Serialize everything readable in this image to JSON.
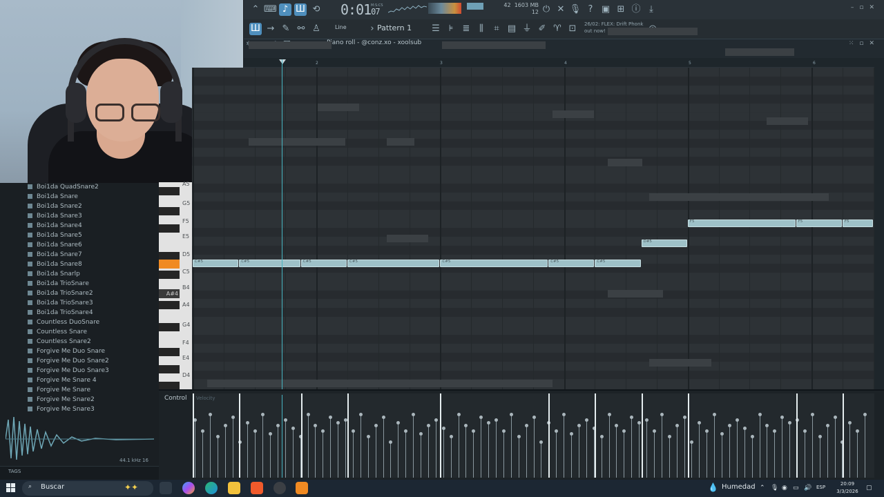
{
  "toolbar": {
    "time_main": "0:01",
    "time_small": "07",
    "time_label": "M:S:CS",
    "cpu_mem": "1603 MB",
    "cpu_voices": "12",
    "cpu_pct": "42",
    "mode": "Line",
    "pattern": "Pattern 1",
    "news_line1": "26/02: FLEX: Drift Phonk",
    "news_line2": "out now!"
  },
  "piano_roll": {
    "title": "Piano roll - @conz.xo - xoolsub",
    "bars": [
      "2",
      "3",
      "4",
      "5",
      "6"
    ],
    "key_labels": [
      "A5",
      "G5",
      "F5",
      "E5",
      "D5",
      "C5",
      "B4",
      "A4",
      "G4",
      "F4",
      "E4",
      "D4"
    ],
    "highlight_key": "A#4",
    "notes": [
      {
        "label": "C#5",
        "pitch": "C#5",
        "start_beat": 0.0,
        "len_beats": 1.5
      },
      {
        "label": "C#5",
        "pitch": "C#5",
        "start_beat": 1.5,
        "len_beats": 2.0
      },
      {
        "label": "C#5",
        "pitch": "C#5",
        "start_beat": 3.5,
        "len_beats": 1.5
      },
      {
        "label": "C#5",
        "pitch": "C#5",
        "start_beat": 5.0,
        "len_beats": 3.0
      },
      {
        "label": "C#5",
        "pitch": "C#5",
        "start_beat": 8.0,
        "len_beats": 3.5
      },
      {
        "label": "C#5",
        "pitch": "C#5",
        "start_beat": 11.5,
        "len_beats": 1.5
      },
      {
        "label": "C#5",
        "pitch": "C#5",
        "start_beat": 13.0,
        "len_beats": 1.5
      },
      {
        "label": "D#5",
        "pitch": "D#5",
        "start_beat": 14.5,
        "len_beats": 1.5
      },
      {
        "label": "F5",
        "pitch": "F5",
        "start_beat": 16.0,
        "len_beats": 3.5
      },
      {
        "label": "F5",
        "pitch": "F5",
        "start_beat": 19.5,
        "len_beats": 1.5
      },
      {
        "label": "F5",
        "pitch": "F5",
        "start_beat": 21.0,
        "len_beats": 1.0
      }
    ]
  },
  "browser": {
    "items": [
      "Boi1da QuadSnare2",
      "Boi1da Snare",
      "Boi1da Snare2",
      "Boi1da Snare3",
      "Boi1da Snare4",
      "Boi1da Snare5",
      "Boi1da Snare6",
      "Boi1da Snare7",
      "Boi1da Snare8",
      "Boi1da Snarlp",
      "Boi1da TrioSnare",
      "Boi1da TrioSnare2",
      "Boi1da TrioSnare3",
      "Boi1da TrioSnare4",
      "Countless DuoSnare",
      "Countless Snare",
      "Countless Snare2",
      "Forgive Me Duo Snare",
      "Forgive Me Duo Snare2",
      "Forgive Me Duo Snare3",
      "Forgive Me Snare 4",
      "Forgive Me Snare",
      "Forgive Me Snare2",
      "Forgive Me Snare3"
    ],
    "sample_rate": "44.1 kHz 16",
    "tags_label": "TAGS"
  },
  "control": {
    "label": "Control",
    "mini_label": "Velocity"
  },
  "taskbar": {
    "search_placeholder": "Buscar",
    "weather": "Humedad",
    "lang": "ESP",
    "time": "20:09",
    "date": "3/3/2026"
  },
  "colors": {
    "note_fill": "#9ec1c8",
    "playhead": "#47b5c2",
    "highlight_key": "#f08a22",
    "accent": "#4f8fbd"
  }
}
